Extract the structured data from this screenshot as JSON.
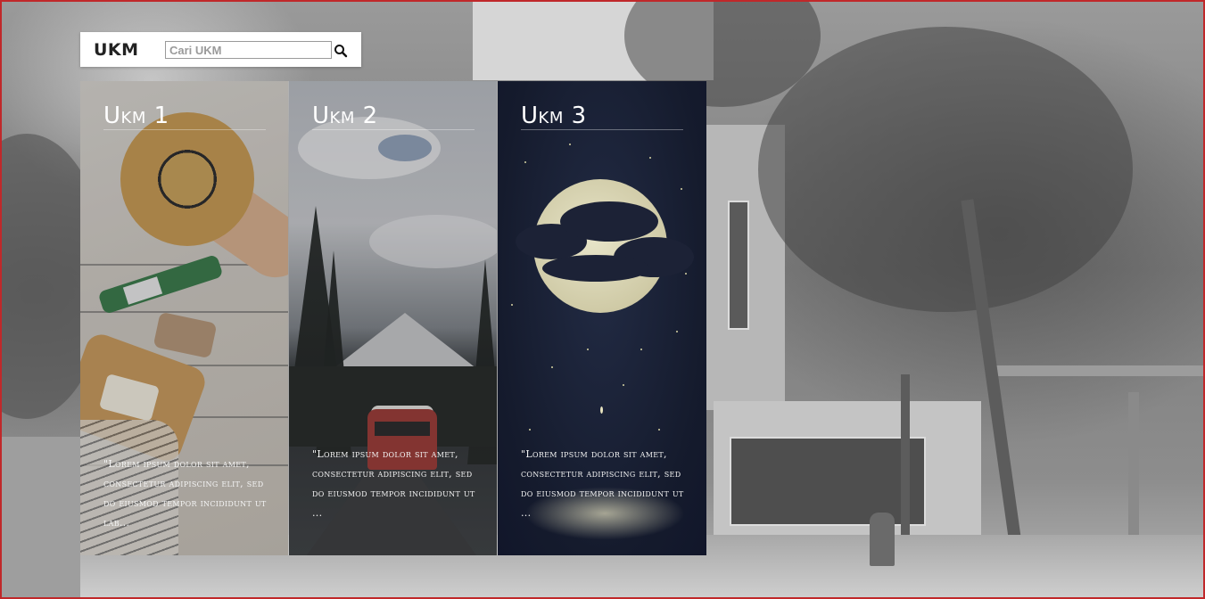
{
  "header": {
    "logo": "UKM",
    "search": {
      "placeholder": "Cari UKM",
      "value": ""
    },
    "search_icon": "search-icon"
  },
  "cards": [
    {
      "title": "Ukm 1",
      "text": "\"Lorem ipsum dolor sit amet, consectetur adipiscing elit, sed do eiusmod tempor incididunt ut lab..."
    },
    {
      "title": "Ukm 2",
      "text": "\"Lorem ipsum dolor sit amet, consectetur adipiscing elit, sed do eiusmod tempor incididunt ut ..."
    },
    {
      "title": "Ukm 3",
      "text": "\"Lorem ipsum dolor sit amet, consectetur adipiscing elit, sed do eiusmod tempor incididunt ut ..."
    }
  ],
  "colors": {
    "frame_border": "#c0282a",
    "header_bg": "#ffffff",
    "card3_bg": "#151b2d"
  }
}
